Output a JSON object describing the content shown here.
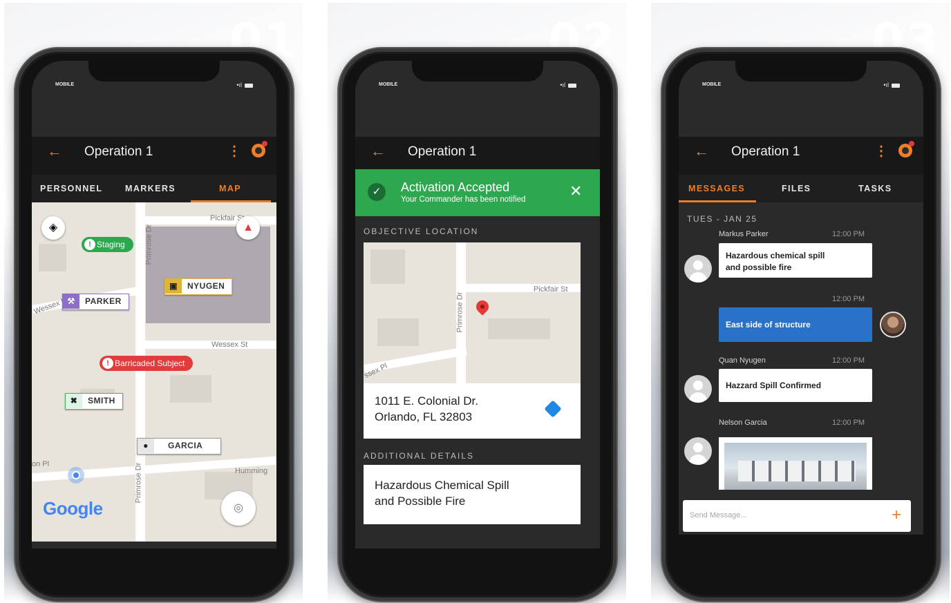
{
  "status": {
    "carrier": "MOBILE",
    "signal": "•ıl"
  },
  "screen1": {
    "step": "01",
    "title": "Operation 1",
    "tabs": [
      "PERSONNEL",
      "MARKERS",
      "MAP"
    ],
    "streets": [
      "Primrose Dr",
      "Pickfair St",
      "Wessex St",
      "Wessex Pl",
      "Primrose Dr",
      "Humming",
      "on Pl"
    ],
    "markers": [
      {
        "label": "NYUGEN",
        "icon": "lock-icon",
        "color": "#e0b33a"
      },
      {
        "label": "PARKER",
        "icon": "hammer-icon",
        "color": "#8e6fc7"
      },
      {
        "label": "SMITH",
        "icon": "tools-icon",
        "color": "#46b36a"
      },
      {
        "label": "GARCIA",
        "icon": "walker-icon",
        "color": "#9a9a9a"
      }
    ],
    "pills": [
      {
        "label": "Staging",
        "icon": "!",
        "color": "#2ea84f"
      },
      {
        "label": "Barricaded Subject",
        "icon": "!",
        "color": "#e23b3b"
      }
    ],
    "google": "Google"
  },
  "screen2": {
    "step": "02",
    "title": "Operation 1",
    "banner_title": "Activation Accepted",
    "banner_sub": "Your Commander has been notified",
    "section1": "OBJECTIVE LOCATION",
    "street_primrose": "Primrose Dr",
    "street_pickfair": "Pickfair St",
    "street_wessex": "ssex Pl",
    "address_line1": "1011 E. Colonial Dr.",
    "address_line2": "Orlando, FL 32803",
    "section2": "ADDITIONAL DETAILS",
    "details_line1": "Hazardous Chemical Spill",
    "details_line2": "and Possible Fire"
  },
  "screen3": {
    "step": "03",
    "title": "Operation 1",
    "tabs": [
      "MESSAGES",
      "FILES",
      "TASKS"
    ],
    "date": "TUES - JAN 25",
    "messages": [
      {
        "sender": "Markus Parker",
        "time": "12:00 PM",
        "text1": "Hazardous chemical spill",
        "text2": "and possible fire"
      },
      {
        "sender": "",
        "time": "12:00 PM",
        "text1": "East side of structure",
        "text2": ""
      },
      {
        "sender": "Quan Nyugen",
        "time": "12:00 PM",
        "text1": "Hazzard Spill Confirmed",
        "text2": ""
      },
      {
        "sender": "Nelson Garcia",
        "time": "12:00 PM",
        "text1": "",
        "text2": ""
      }
    ],
    "send_placeholder": "Send Message...",
    "send_plus": "+"
  },
  "colors": {
    "accent": "#f07e26",
    "success": "#2ea84f",
    "alert": "#e23b3b",
    "message_blue": "#2a72c9"
  }
}
